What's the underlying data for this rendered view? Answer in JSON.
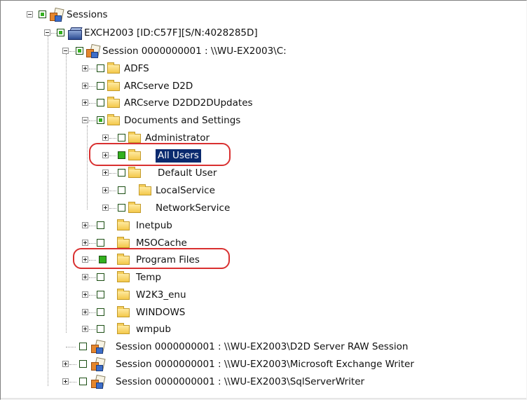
{
  "tree": {
    "sessions_label": "Sessions",
    "server_label": "EXCH2003 [ID:C57F][S/N:4028285D]",
    "session_c_label": "Session 0000000001 : \\\\WU-EX2003\\C:",
    "folders": {
      "adfs": "ADFS",
      "arcserve_d2d": "ARCserve D2D",
      "arcserve_d2dd2dupdates": "ARCserve D2DD2DUpdates",
      "documents_and_settings": "Documents and Settings",
      "administrator": "Administrator",
      "all_users": "All Users",
      "default_user": "Default User",
      "localservice": "LocalService",
      "networkservice": "NetworkService",
      "inetpub": "Inetpub",
      "msocache": "MSOCache",
      "program_files": "Program Files",
      "temp": "Temp",
      "w2k3_enu": "W2K3_enu",
      "windows": "WINDOWS",
      "wmpub": "wmpub"
    },
    "session_raw_label": "Session 0000000001 : \\\\WU-EX2003\\D2D Server RAW Session",
    "session_exchange_label": "Session 0000000001 : \\\\WU-EX2003\\Microsoft Exchange Writer",
    "session_sql_label": "Session 0000000001 : \\\\WU-EX2003\\SqlServerWriter"
  },
  "colors": {
    "selection": "#0a2a6e",
    "highlight_ring": "#d93030",
    "checkbox_green": "#33b01e"
  }
}
